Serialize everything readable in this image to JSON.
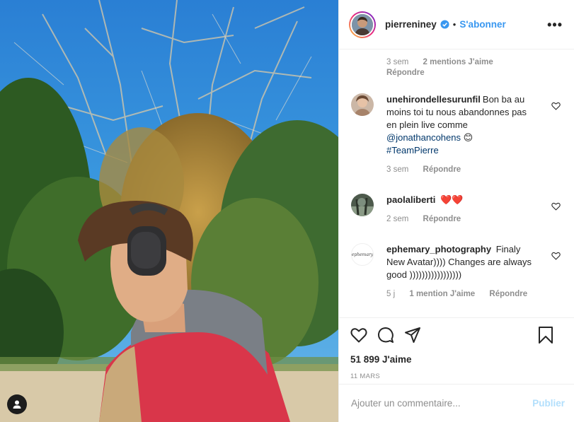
{
  "post": {
    "author": "pierreniney",
    "separator": "•",
    "follow_label": "S'abonner",
    "more_label": "•••"
  },
  "top_comment": {
    "age": "3 sem",
    "likes": "2 mentions J'aime",
    "reply_label": "Répondre"
  },
  "comments": [
    {
      "user": "unehirondellesurunfil",
      "text_1": "Bon ba au moins toi tu nous abandonnes pas en plein live comme ",
      "mention": "@jonathancohens",
      "emoji": "😊",
      "hashtag": "#TeamPierre",
      "age": "3 sem",
      "reply_label": "Répondre"
    },
    {
      "user": "paolaliberti",
      "text": "❤️❤️",
      "age": "2 sem",
      "reply_label": "Répondre"
    },
    {
      "user": "ephemary_photography",
      "text": "Finaly New Avatar)))) Changes are always good )))))))))))))))))",
      "avatar_text": "ephemary",
      "age": "5 j",
      "likes": "1 mention J'aime",
      "reply_label": "Répondre"
    }
  ],
  "actions": {
    "likes_count": "51 899 J'aime",
    "date": "11 MARS"
  },
  "add_comment": {
    "placeholder": "Ajouter un commentaire...",
    "publish_label": "Publier"
  },
  "colors": {
    "link_blue": "#3897f0",
    "mention_blue": "#00376b",
    "muted_gray": "#8e8e8e",
    "publish_disabled": "#b2dffc"
  }
}
